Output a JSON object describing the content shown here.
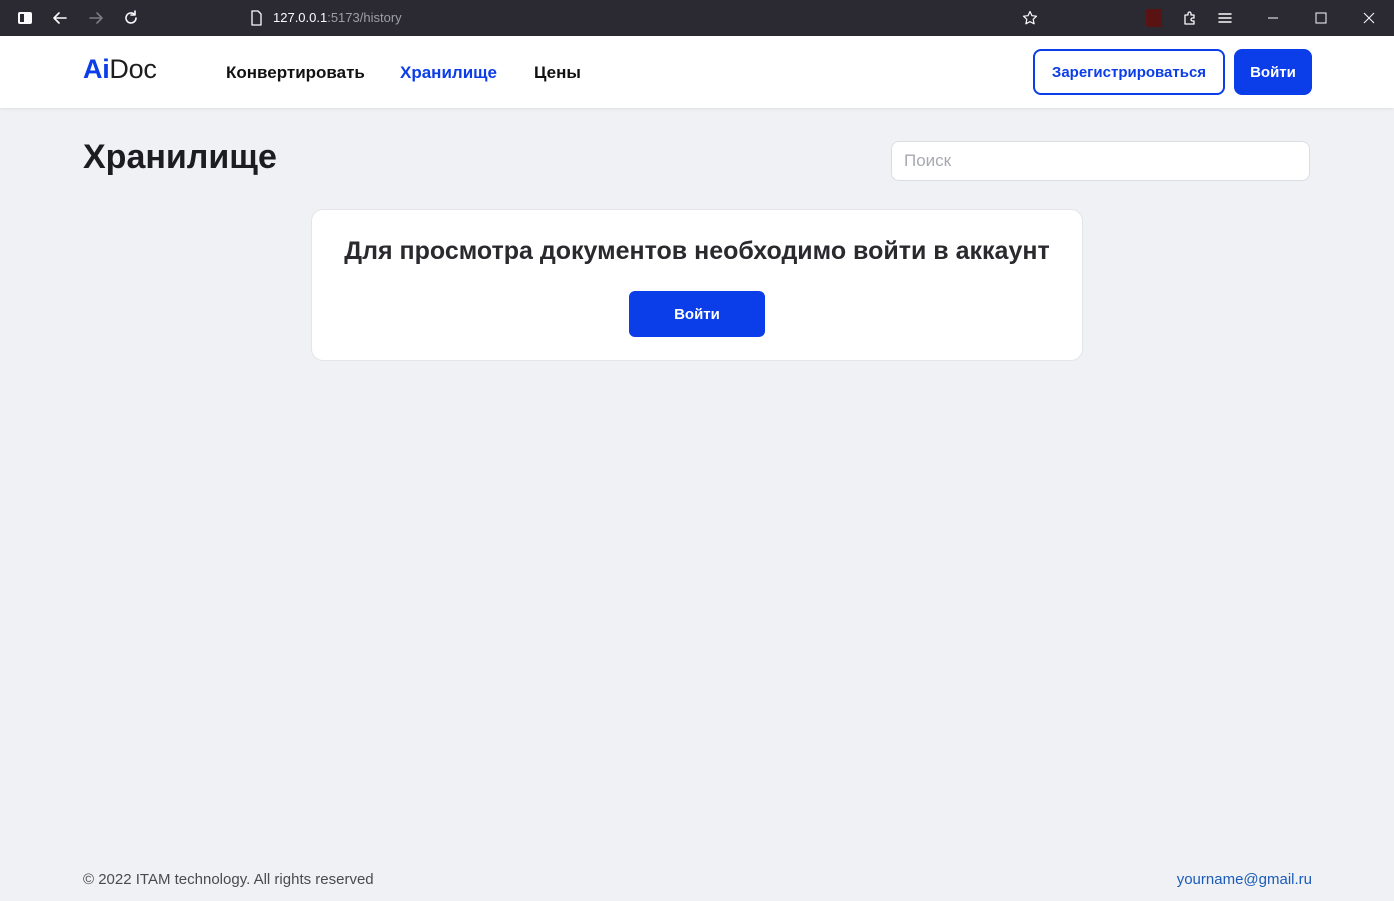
{
  "browser": {
    "url_host": "127.0.0.1",
    "url_path": ":5173/history",
    "colors": {
      "chrome_bg": "#2b2a33",
      "text": "#fbfbfe"
    }
  },
  "header": {
    "logo_ai": "Ai",
    "logo_doc": "Doc",
    "nav": [
      {
        "label": "Конвертировать",
        "active": false
      },
      {
        "label": "Хранилище",
        "active": true
      },
      {
        "label": "Цены",
        "active": false
      }
    ],
    "register_label": "Зарегистрироваться",
    "login_label": "Войти"
  },
  "main": {
    "title": "Хранилище",
    "search_placeholder": "Поиск",
    "card": {
      "message": "Для просмотра документов необходимо войти в аккаунт",
      "button_label": "Войти"
    }
  },
  "footer": {
    "copyright": "© 2022 ITAM technology. All rights reserved",
    "email": "yourname@gmail.ru"
  },
  "icons": [
    "sidebar-icon",
    "back-arrow-icon",
    "forward-arrow-icon",
    "reload-icon",
    "page-icon",
    "bookmark-star-icon",
    "extension-badge-icon",
    "extensions-puzzle-icon",
    "menu-icon",
    "minimize-icon",
    "maximize-icon",
    "close-icon"
  ],
  "colors": {
    "accent": "#0b3de8",
    "page_bg": "#f0f1f5",
    "email_link": "#1a5bb8"
  }
}
